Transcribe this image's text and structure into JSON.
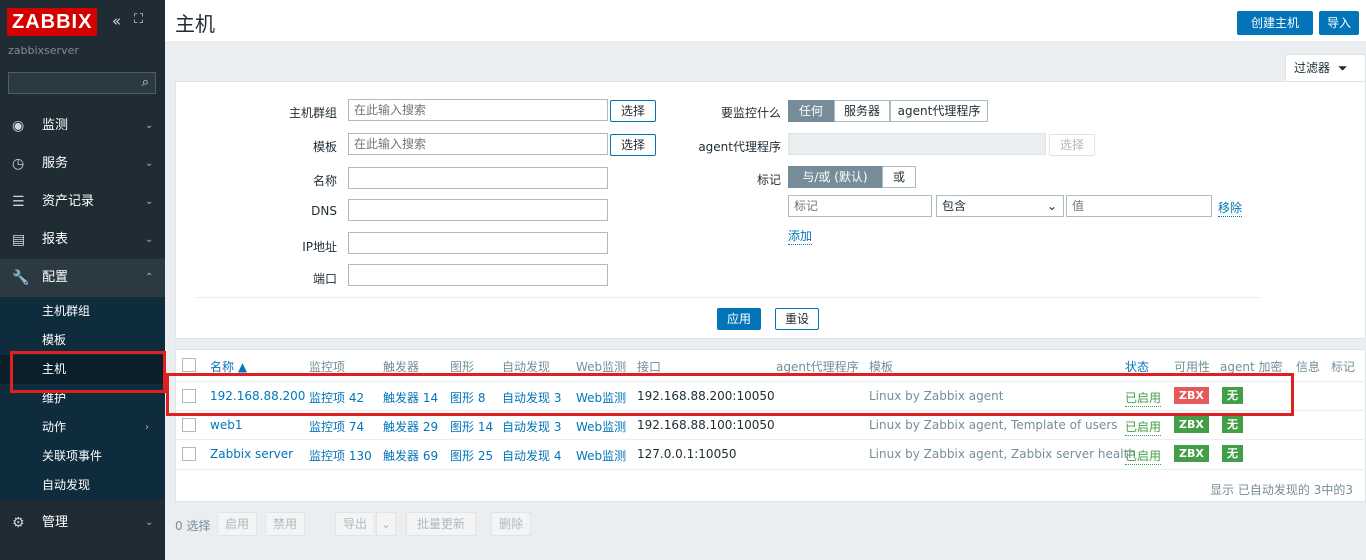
{
  "sidebar": {
    "logo": "ZABBIX",
    "server": "zabbixserver",
    "search_placeholder": "",
    "nav": [
      {
        "label": "监测",
        "icon": "eye-icon"
      },
      {
        "label": "服务",
        "icon": "clock-icon"
      },
      {
        "label": "资产记录",
        "icon": "list-icon"
      },
      {
        "label": "报表",
        "icon": "chart-icon"
      },
      {
        "label": "配置",
        "icon": "wrench-icon"
      },
      {
        "label": "管理",
        "icon": "gear-icon"
      }
    ],
    "sub": [
      "主机群组",
      "模板",
      "主机",
      "维护",
      "动作",
      "关联项事件",
      "自动发现"
    ]
  },
  "header": {
    "title": "主机",
    "create_btn": "创建主机",
    "import_btn": "导入"
  },
  "filter": {
    "tab_label": "过滤器",
    "host_group_label": "主机群组",
    "host_group_placeholder": "在此输入搜索",
    "template_label": "模板",
    "template_placeholder": "在此输入搜索",
    "select": "选择",
    "name_label": "名称",
    "dns_label": "DNS",
    "ip_label": "IP地址",
    "port_label": "端口",
    "monitored_label": "要监控什么",
    "monitored_options": [
      "任何",
      "服务器",
      "agent代理程序"
    ],
    "proxy_label": "agent代理程序",
    "tags_label": "标记",
    "tags_options": [
      "与/或 (默认)",
      "或"
    ],
    "tag_placeholder": "标记",
    "tag_op": "包含",
    "value_placeholder": "值",
    "remove": "移除",
    "add": "添加",
    "apply": "应用",
    "reset": "重设"
  },
  "table": {
    "headers": [
      "名称 ▲",
      "监控项",
      "触发器",
      "图形",
      "自动发现",
      "Web监测",
      "接口",
      "agent代理程序",
      "模板",
      "状态",
      "可用性",
      "agent 加密",
      "信息",
      "标记"
    ],
    "rows": [
      {
        "name": "192.168.88.200",
        "items": "监控项 42",
        "triggers": "触发器 14",
        "graphs": "图形 8",
        "discovery": "自动发现 3",
        "web": "Web监测",
        "iface": "192.168.88.200:10050",
        "templates": "Linux by Zabbix agent",
        "status": "已启用",
        "avail": "ZBX",
        "encr": "无"
      },
      {
        "name": "web1",
        "items": "监控项 74",
        "triggers": "触发器 29",
        "graphs": "图形 14",
        "discovery": "自动发现 3",
        "web": "Web监测",
        "iface": "192.168.88.100:10050",
        "templates": "Linux by Zabbix agent, Template of users",
        "status": "已启用",
        "avail": "ZBX",
        "encr": "无"
      },
      {
        "name": "Zabbix server",
        "items": "监控项 130",
        "triggers": "触发器 69",
        "graphs": "图形 25",
        "discovery": "自动发现 4",
        "web": "Web监测",
        "iface": "127.0.0.1:10050",
        "templates": "Linux by Zabbix agent, Zabbix server health",
        "status": "已启用",
        "avail": "ZBX",
        "encr": "无"
      }
    ],
    "footer": "显示 已自动发现的 3中的3"
  },
  "bulk": {
    "selected": "0 选择",
    "enable": "启用",
    "disable": "禁用",
    "export": "导出",
    "mass_update": "批量更新",
    "delete": "删除"
  },
  "colors": {
    "accent": "#0275b8",
    "sidebar": "#1f2c33",
    "highlight": "#e02020",
    "red_badge": "#e45959",
    "green_badge": "#429e47"
  }
}
